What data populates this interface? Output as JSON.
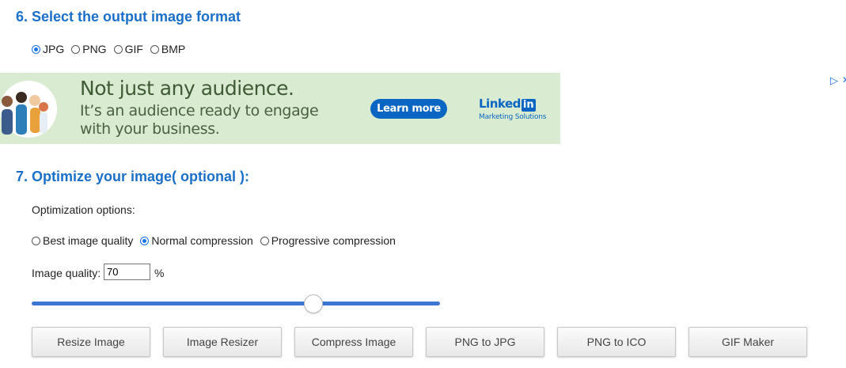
{
  "step6": {
    "title": "6. Select the output image format",
    "formats": [
      {
        "label": "JPG",
        "checked": true
      },
      {
        "label": "PNG",
        "checked": false
      },
      {
        "label": "GIF",
        "checked": false
      },
      {
        "label": "BMP",
        "checked": false
      }
    ]
  },
  "ad": {
    "headline": "Not just any audience.",
    "body": "It’s an audience ready to engage with your business.",
    "cta": "Learn more",
    "brand_word": "Linked",
    "brand_box": "in",
    "brand_sub": "Marketing Solutions",
    "adchoices_icon": "play-triangle-icon",
    "close_icon": "close-icon",
    "bg_color": "#d9ebd0",
    "accent_color": "#0a66c2"
  },
  "step7": {
    "title": "7. Optimize your image( optional ):",
    "options_label": "Optimization options:",
    "compression": [
      {
        "label": "Best image quality",
        "checked": false
      },
      {
        "label": "Normal compression",
        "checked": true
      },
      {
        "label": "Progressive compression",
        "checked": false
      }
    ],
    "quality_label": "Image quality:",
    "quality_value": "70",
    "quality_unit": "%",
    "slider_fraction": 0.69
  },
  "tools": [
    "Resize Image",
    "Image Resizer",
    "Compress Image",
    "PNG to JPG",
    "PNG to ICO",
    "GIF Maker"
  ],
  "colors": {
    "title": "#1a6fc9",
    "radio_checked": "#1a73e8",
    "slider": "#3b76d4"
  }
}
